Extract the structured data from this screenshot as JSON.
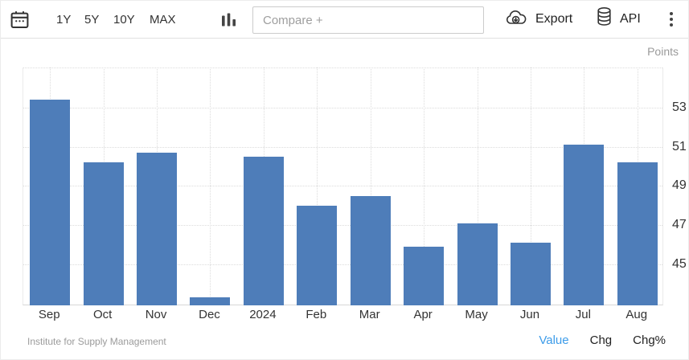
{
  "toolbar": {
    "ranges": [
      "1Y",
      "5Y",
      "10Y",
      "MAX"
    ],
    "compare_placeholder": "Compare +",
    "export_label": "Export",
    "api_label": "API"
  },
  "chart_data": {
    "type": "bar",
    "categories": [
      "Sep",
      "Oct",
      "Nov",
      "Dec",
      "2024",
      "Feb",
      "Mar",
      "Apr",
      "May",
      "Jun",
      "Jul",
      "Aug"
    ],
    "values": [
      53.4,
      50.2,
      50.7,
      43.3,
      50.5,
      48.0,
      48.5,
      45.9,
      47.1,
      46.1,
      51.1,
      50.2
    ],
    "title": "",
    "xlabel": "",
    "ylabel": "Points",
    "yticks": [
      45,
      47,
      49,
      51,
      53
    ],
    "ylim": [
      42.9,
      55.05
    ],
    "grid": true,
    "legend_position": "none",
    "bar_color": "#4e7db9",
    "source": "Institute for Supply Management"
  },
  "footer": {
    "source": "Institute for Supply Management",
    "links": [
      "Value",
      "Chg",
      "Chg%"
    ],
    "active_link": "Value"
  },
  "colors": {
    "bar": "#4e7db9",
    "active_link": "#3d9ce9",
    "axis_text": "#333333",
    "muted_text": "#9a9a9a"
  }
}
